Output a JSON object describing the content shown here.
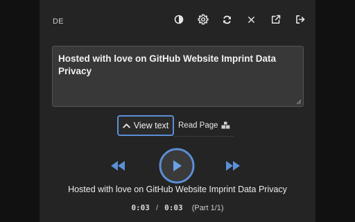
{
  "header": {
    "language": "DE",
    "icons": [
      {
        "name": "contrast-icon"
      },
      {
        "name": "gear-icon"
      },
      {
        "name": "refresh-icon"
      },
      {
        "name": "close-icon"
      },
      {
        "name": "external-link-icon"
      },
      {
        "name": "logout-icon"
      }
    ]
  },
  "textbox": {
    "value": "Hosted with love on GitHub Website Imprint Data Privacy"
  },
  "view_toggle": {
    "view_text_label": "View text",
    "read_page_label": "Read Page"
  },
  "player": {
    "caption": "Hosted with love on GitHub Website Imprint Data Privacy",
    "current_time": "0:03",
    "separator": "/",
    "total_time": "0:03",
    "part": "(Part 1/1)"
  },
  "colors": {
    "accent": "#5b8fd6",
    "panel_bg": "#242424",
    "page_bg": "#111111"
  }
}
